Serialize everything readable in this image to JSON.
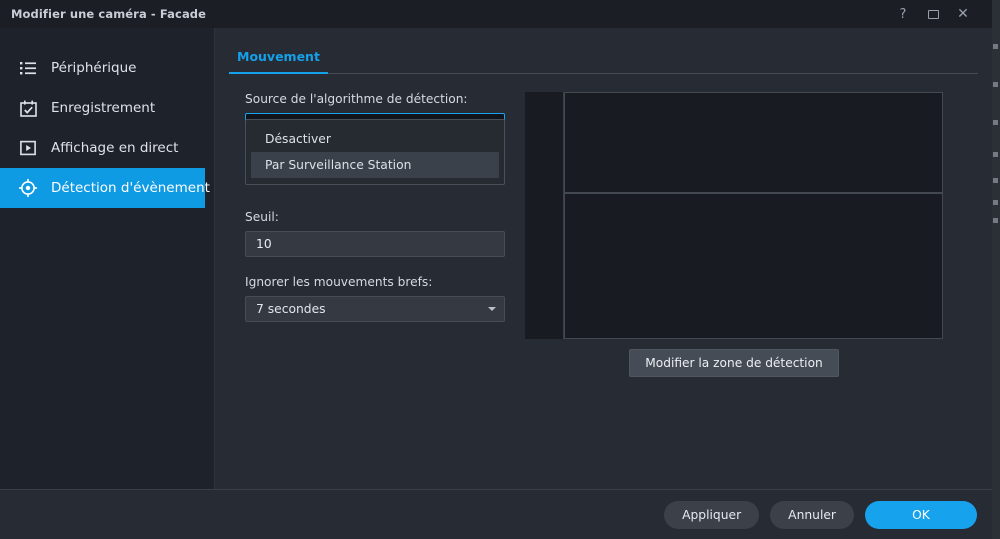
{
  "window": {
    "title": "Modifier une caméra - Facade",
    "controls": [
      {
        "name": "help-button",
        "glyph": "?"
      },
      {
        "name": "restore-button",
        "glyph": ""
      },
      {
        "name": "close-button",
        "glyph": "✕"
      }
    ]
  },
  "colors": {
    "accent": "#0f9ae4",
    "tab_accent": "#15a0ea",
    "focus_border": "#1aa3ee",
    "window_bg": "#272b33",
    "sidebar_bg": "#1e222a",
    "titlebar_bg": "#1b1e24",
    "video_bg": "#181c22"
  },
  "sidebar": {
    "items": [
      {
        "label": "Périphérique",
        "icon": "list-icon",
        "active": false
      },
      {
        "label": "Enregistrement",
        "icon": "calendar-check-icon",
        "active": false
      },
      {
        "label": "Affichage en direct",
        "icon": "play-box-icon",
        "active": false
      },
      {
        "label": "Détection d'évènement",
        "icon": "motion-target-icon",
        "active": true
      }
    ]
  },
  "tabs": [
    {
      "label": "Mouvement",
      "active": true
    }
  ],
  "form": {
    "source": {
      "label": "Source de l'algorithme de détection:",
      "value": "Par Surveillance Station",
      "expanded": true,
      "options": [
        {
          "label": "Désactiver",
          "selected": false
        },
        {
          "label": "Par Surveillance Station",
          "selected": true
        }
      ]
    },
    "threshold": {
      "label": "Seuil:",
      "value": "10"
    },
    "ignore_short": {
      "label": "Ignorer les mouvements brefs:",
      "value": "7 secondes"
    }
  },
  "preview": {
    "zone_button": "Modifier la zone de détection"
  },
  "footer": {
    "apply": "Appliquer",
    "cancel": "Annuler",
    "ok": "OK"
  }
}
